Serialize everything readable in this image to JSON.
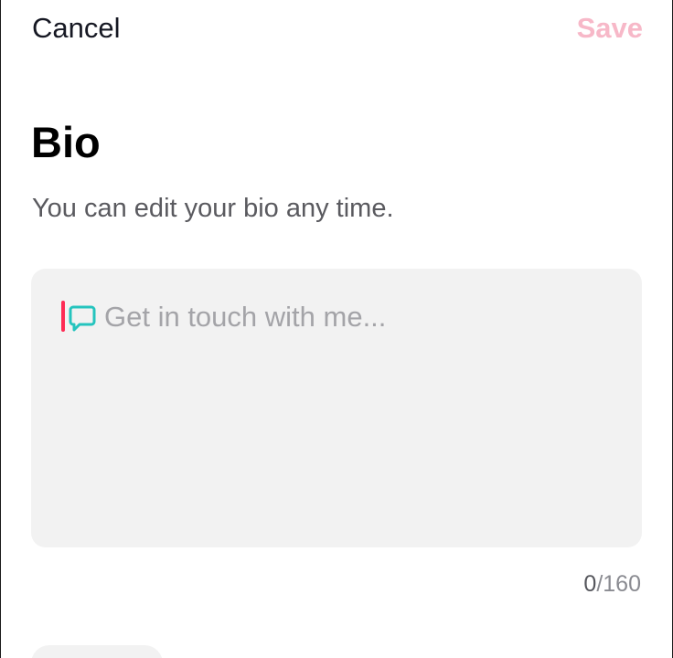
{
  "header": {
    "cancel_label": "Cancel",
    "save_label": "Save"
  },
  "main": {
    "title": "Bio",
    "subtitle": "You can edit your bio any time."
  },
  "bio_input": {
    "value": "",
    "placeholder": "Get in touch with me...",
    "icon": "chat-bubble-icon"
  },
  "counter": {
    "current": "0",
    "max": "/160"
  },
  "colors": {
    "save_disabled": "#f7b8c8",
    "caret": "#fe2c55",
    "bubble_icon": "#25c4be",
    "input_background": "#f2f2f2"
  }
}
